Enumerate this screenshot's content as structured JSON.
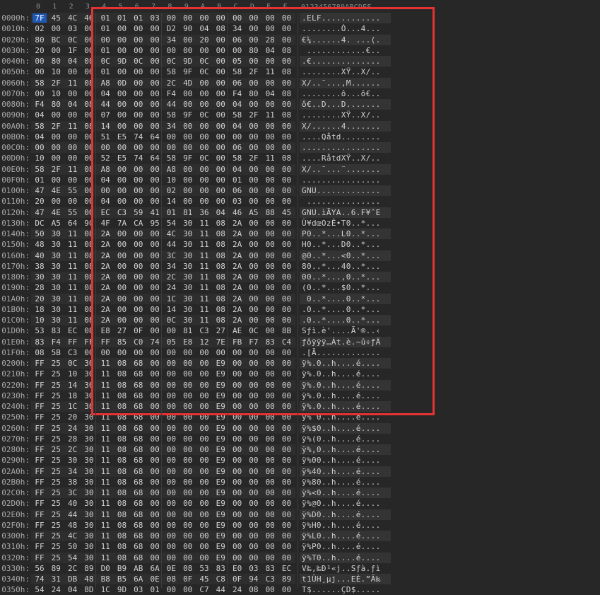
{
  "columns": [
    "0",
    "1",
    "2",
    "3",
    "4",
    "5",
    "6",
    "7",
    "8",
    "9",
    "A",
    "B",
    "C",
    "D",
    "E",
    "F"
  ],
  "ascii_header": "0123456789ABCDEF",
  "rows": [
    {
      "offset": "0000h:",
      "bytes": [
        "7F",
        "45",
        "4C",
        "46",
        "01",
        "01",
        "01",
        "03",
        "00",
        "00",
        "00",
        "00",
        "00",
        "00",
        "00",
        "00"
      ],
      "ascii": ".ELF............"
    },
    {
      "offset": "0010h:",
      "bytes": [
        "02",
        "00",
        "03",
        "00",
        "01",
        "00",
        "00",
        "00",
        "D2",
        "90",
        "04",
        "08",
        "34",
        "00",
        "00",
        "00"
      ],
      "ascii": "........Ò...4..."
    },
    {
      "offset": "0020h:",
      "bytes": [
        "80",
        "BC",
        "0C",
        "00",
        "00",
        "00",
        "00",
        "00",
        "34",
        "00",
        "20",
        "00",
        "06",
        "00",
        "28",
        "00"
      ],
      "ascii": "€¼......4. ...(."
    },
    {
      "offset": "0030h:",
      "bytes": [
        "20",
        "00",
        "1F",
        "00",
        "01",
        "00",
        "00",
        "00",
        "00",
        "00",
        "00",
        "00",
        "00",
        "80",
        "04",
        "08"
      ],
      "ascii": " ............€.."
    },
    {
      "offset": "0040h:",
      "bytes": [
        "00",
        "80",
        "04",
        "08",
        "0C",
        "9D",
        "0C",
        "00",
        "0C",
        "9D",
        "0C",
        "00",
        "05",
        "00",
        "00",
        "00"
      ],
      "ascii": ".€.............."
    },
    {
      "offset": "0050h:",
      "bytes": [
        "00",
        "10",
        "00",
        "00",
        "01",
        "00",
        "00",
        "00",
        "58",
        "9F",
        "0C",
        "00",
        "58",
        "2F",
        "11",
        "08"
      ],
      "ascii": "........XŸ..X/.."
    },
    {
      "offset": "0060h:",
      "bytes": [
        "58",
        "2F",
        "11",
        "08",
        "A8",
        "0D",
        "00",
        "00",
        "2C",
        "4D",
        "00",
        "00",
        "06",
        "00",
        "00",
        "00"
      ],
      "ascii": "X/..¨...,M......"
    },
    {
      "offset": "0070h:",
      "bytes": [
        "00",
        "10",
        "00",
        "00",
        "04",
        "00",
        "00",
        "00",
        "F4",
        "00",
        "00",
        "00",
        "F4",
        "80",
        "04",
        "08"
      ],
      "ascii": "........ô...ô€.."
    },
    {
      "offset": "0080h:",
      "bytes": [
        "F4",
        "80",
        "04",
        "08",
        "44",
        "00",
        "00",
        "00",
        "44",
        "00",
        "00",
        "00",
        "04",
        "00",
        "00",
        "00"
      ],
      "ascii": "ô€..D...D......."
    },
    {
      "offset": "0090h:",
      "bytes": [
        "04",
        "00",
        "00",
        "00",
        "07",
        "00",
        "00",
        "00",
        "58",
        "9F",
        "0C",
        "00",
        "58",
        "2F",
        "11",
        "08"
      ],
      "ascii": "........XŸ..X/.."
    },
    {
      "offset": "00A0h:",
      "bytes": [
        "58",
        "2F",
        "11",
        "08",
        "14",
        "00",
        "00",
        "00",
        "34",
        "00",
        "00",
        "00",
        "04",
        "00",
        "00",
        "00"
      ],
      "ascii": "X/......4......."
    },
    {
      "offset": "00B0h:",
      "bytes": [
        "04",
        "00",
        "00",
        "00",
        "51",
        "E5",
        "74",
        "64",
        "00",
        "00",
        "00",
        "00",
        "00",
        "00",
        "00",
        "00"
      ],
      "ascii": "....Qåtd........"
    },
    {
      "offset": "00C0h:",
      "bytes": [
        "00",
        "00",
        "00",
        "00",
        "00",
        "00",
        "00",
        "00",
        "00",
        "00",
        "00",
        "00",
        "06",
        "00",
        "00",
        "00"
      ],
      "ascii": "................"
    },
    {
      "offset": "00D0h:",
      "bytes": [
        "10",
        "00",
        "00",
        "00",
        "52",
        "E5",
        "74",
        "64",
        "58",
        "9F",
        "0C",
        "00",
        "58",
        "2F",
        "11",
        "08"
      ],
      "ascii": "....RåtdXŸ..X/.."
    },
    {
      "offset": "00E0h:",
      "bytes": [
        "58",
        "2F",
        "11",
        "08",
        "A8",
        "00",
        "00",
        "00",
        "A8",
        "00",
        "00",
        "00",
        "04",
        "00",
        "00",
        "00"
      ],
      "ascii": "X/..¨...¨......."
    },
    {
      "offset": "00F0h:",
      "bytes": [
        "01",
        "00",
        "00",
        "00",
        "04",
        "00",
        "00",
        "00",
        "10",
        "00",
        "00",
        "00",
        "01",
        "00",
        "00",
        "00"
      ],
      "ascii": "................"
    },
    {
      "offset": "0100h:",
      "bytes": [
        "47",
        "4E",
        "55",
        "00",
        "00",
        "00",
        "00",
        "00",
        "02",
        "00",
        "00",
        "00",
        "06",
        "00",
        "00",
        "00"
      ],
      "ascii": "GNU............."
    },
    {
      "offset": "0110h:",
      "bytes": [
        "20",
        "00",
        "00",
        "00",
        "04",
        "00",
        "00",
        "00",
        "14",
        "00",
        "00",
        "00",
        "03",
        "00",
        "00",
        "00"
      ],
      "ascii": " ..............."
    },
    {
      "offset": "0120h:",
      "bytes": [
        "47",
        "4E",
        "55",
        "00",
        "EC",
        "C3",
        "59",
        "41",
        "01",
        "81",
        "36",
        "04",
        "46",
        "A5",
        "88",
        "45"
      ],
      "ascii": "GNU.ìÃYA..6.F¥ˆE"
    },
    {
      "offset": "0130h:",
      "bytes": [
        "DC",
        "A5",
        "64",
        "9C",
        "4F",
        "7A",
        "CA",
        "95",
        "54",
        "30",
        "11",
        "08",
        "2A",
        "00",
        "00",
        "00"
      ],
      "ascii": "Ü¥dœOzÊ•T0..*..."
    },
    {
      "offset": "0140h:",
      "bytes": [
        "50",
        "30",
        "11",
        "08",
        "2A",
        "00",
        "00",
        "00",
        "4C",
        "30",
        "11",
        "08",
        "2A",
        "00",
        "00",
        "00"
      ],
      "ascii": "P0..*...L0..*..."
    },
    {
      "offset": "0150h:",
      "bytes": [
        "48",
        "30",
        "11",
        "08",
        "2A",
        "00",
        "00",
        "00",
        "44",
        "30",
        "11",
        "08",
        "2A",
        "00",
        "00",
        "00"
      ],
      "ascii": "H0..*...D0..*..."
    },
    {
      "offset": "0160h:",
      "bytes": [
        "40",
        "30",
        "11",
        "08",
        "2A",
        "00",
        "00",
        "00",
        "3C",
        "30",
        "11",
        "08",
        "2A",
        "00",
        "00",
        "00"
      ],
      "ascii": "@0..*...<0..*..."
    },
    {
      "offset": "0170h:",
      "bytes": [
        "38",
        "30",
        "11",
        "08",
        "2A",
        "00",
        "00",
        "00",
        "34",
        "30",
        "11",
        "08",
        "2A",
        "00",
        "00",
        "00"
      ],
      "ascii": "80..*...40..*..."
    },
    {
      "offset": "0180h:",
      "bytes": [
        "30",
        "30",
        "11",
        "08",
        "2A",
        "00",
        "00",
        "00",
        "2C",
        "30",
        "11",
        "08",
        "2A",
        "00",
        "00",
        "00"
      ],
      "ascii": "00..*...,0..*..."
    },
    {
      "offset": "0190h:",
      "bytes": [
        "28",
        "30",
        "11",
        "08",
        "2A",
        "00",
        "00",
        "00",
        "24",
        "30",
        "11",
        "08",
        "2A",
        "00",
        "00",
        "00"
      ],
      "ascii": "(0..*...$0..*..."
    },
    {
      "offset": "01A0h:",
      "bytes": [
        "20",
        "30",
        "11",
        "08",
        "2A",
        "00",
        "00",
        "00",
        "1C",
        "30",
        "11",
        "08",
        "2A",
        "00",
        "00",
        "00"
      ],
      "ascii": " 0..*....0..*..."
    },
    {
      "offset": "01B0h:",
      "bytes": [
        "18",
        "30",
        "11",
        "08",
        "2A",
        "00",
        "00",
        "00",
        "14",
        "30",
        "11",
        "08",
        "2A",
        "00",
        "00",
        "00"
      ],
      "ascii": ".0..*....0..*..."
    },
    {
      "offset": "01C0h:",
      "bytes": [
        "10",
        "30",
        "11",
        "08",
        "2A",
        "00",
        "00",
        "00",
        "0C",
        "30",
        "11",
        "08",
        "2A",
        "00",
        "00",
        "00"
      ],
      "ascii": ".0..*....0..*..."
    },
    {
      "offset": "01D0h:",
      "bytes": [
        "53",
        "83",
        "EC",
        "08",
        "E8",
        "27",
        "0F",
        "00",
        "00",
        "81",
        "C3",
        "27",
        "AE",
        "0C",
        "00",
        "8B"
      ],
      "ascii": "Sƒì.è'....Ã'®..‹"
    },
    {
      "offset": "01E0h:",
      "bytes": [
        "83",
        "F4",
        "FF",
        "FF",
        "FF",
        "85",
        "C0",
        "74",
        "05",
        "E8",
        "12",
        "7E",
        "FB",
        "F7",
        "83",
        "C4"
      ],
      "ascii": "ƒôÿÿÿ…Àt.è.~û÷ƒÄ"
    },
    {
      "offset": "01F0h:",
      "bytes": [
        "08",
        "5B",
        "C3",
        "00",
        "00",
        "00",
        "00",
        "00",
        "00",
        "00",
        "00",
        "00",
        "00",
        "00",
        "00",
        "00"
      ],
      "ascii": ".[Ã............."
    },
    {
      "offset": "0200h:",
      "bytes": [
        "FF",
        "25",
        "0C",
        "30",
        "11",
        "08",
        "68",
        "00",
        "00",
        "00",
        "00",
        "E9",
        "00",
        "00",
        "00",
        "00"
      ],
      "ascii": "ÿ%.0..h....é...."
    },
    {
      "offset": "0210h:",
      "bytes": [
        "FF",
        "25",
        "10",
        "30",
        "11",
        "08",
        "68",
        "00",
        "00",
        "00",
        "00",
        "E9",
        "00",
        "00",
        "00",
        "00"
      ],
      "ascii": "ÿ%.0..h....é...."
    },
    {
      "offset": "0220h:",
      "bytes": [
        "FF",
        "25",
        "14",
        "30",
        "11",
        "08",
        "68",
        "00",
        "00",
        "00",
        "00",
        "E9",
        "00",
        "00",
        "00",
        "00"
      ],
      "ascii": "ÿ%.0..h....é...."
    },
    {
      "offset": "0230h:",
      "bytes": [
        "FF",
        "25",
        "18",
        "30",
        "11",
        "08",
        "68",
        "00",
        "00",
        "00",
        "00",
        "E9",
        "00",
        "00",
        "00",
        "00"
      ],
      "ascii": "ÿ%.0..h....é...."
    },
    {
      "offset": "0240h:",
      "bytes": [
        "FF",
        "25",
        "1C",
        "30",
        "11",
        "08",
        "68",
        "00",
        "00",
        "00",
        "00",
        "E9",
        "00",
        "00",
        "00",
        "00"
      ],
      "ascii": "ÿ%.0..h....é...."
    },
    {
      "offset": "0250h:",
      "bytes": [
        "FF",
        "25",
        "20",
        "30",
        "11",
        "08",
        "68",
        "00",
        "00",
        "00",
        "00",
        "E9",
        "00",
        "00",
        "00",
        "00"
      ],
      "ascii": "ÿ% 0..h....é...."
    },
    {
      "offset": "0260h:",
      "bytes": [
        "FF",
        "25",
        "24",
        "30",
        "11",
        "08",
        "68",
        "00",
        "00",
        "00",
        "00",
        "E9",
        "00",
        "00",
        "00",
        "00"
      ],
      "ascii": "ÿ%$0..h....é...."
    },
    {
      "offset": "0270h:",
      "bytes": [
        "FF",
        "25",
        "28",
        "30",
        "11",
        "08",
        "68",
        "00",
        "00",
        "00",
        "00",
        "E9",
        "00",
        "00",
        "00",
        "00"
      ],
      "ascii": "ÿ%(0..h....é...."
    },
    {
      "offset": "0280h:",
      "bytes": [
        "FF",
        "25",
        "2C",
        "30",
        "11",
        "08",
        "68",
        "00",
        "00",
        "00",
        "00",
        "E9",
        "00",
        "00",
        "00",
        "00"
      ],
      "ascii": "ÿ%,0..h....é...."
    },
    {
      "offset": "0290h:",
      "bytes": [
        "FF",
        "25",
        "30",
        "30",
        "11",
        "08",
        "68",
        "00",
        "00",
        "00",
        "00",
        "E9",
        "00",
        "00",
        "00",
        "00"
      ],
      "ascii": "ÿ%00..h....é...."
    },
    {
      "offset": "02A0h:",
      "bytes": [
        "FF",
        "25",
        "34",
        "30",
        "11",
        "08",
        "68",
        "00",
        "00",
        "00",
        "00",
        "E9",
        "00",
        "00",
        "00",
        "00"
      ],
      "ascii": "ÿ%40..h....é...."
    },
    {
      "offset": "02B0h:",
      "bytes": [
        "FF",
        "25",
        "38",
        "30",
        "11",
        "08",
        "68",
        "00",
        "00",
        "00",
        "00",
        "E9",
        "00",
        "00",
        "00",
        "00"
      ],
      "ascii": "ÿ%80..h....é...."
    },
    {
      "offset": "02C0h:",
      "bytes": [
        "FF",
        "25",
        "3C",
        "30",
        "11",
        "08",
        "68",
        "00",
        "00",
        "00",
        "00",
        "E9",
        "00",
        "00",
        "00",
        "00"
      ],
      "ascii": "ÿ%<0..h....é...."
    },
    {
      "offset": "02D0h:",
      "bytes": [
        "FF",
        "25",
        "40",
        "30",
        "11",
        "08",
        "68",
        "00",
        "00",
        "00",
        "00",
        "E9",
        "00",
        "00",
        "00",
        "00"
      ],
      "ascii": "ÿ%@0..h....é...."
    },
    {
      "offset": "02E0h:",
      "bytes": [
        "FF",
        "25",
        "44",
        "30",
        "11",
        "08",
        "68",
        "00",
        "00",
        "00",
        "00",
        "E9",
        "00",
        "00",
        "00",
        "00"
      ],
      "ascii": "ÿ%D0..h....é...."
    },
    {
      "offset": "02F0h:",
      "bytes": [
        "FF",
        "25",
        "48",
        "30",
        "11",
        "08",
        "68",
        "00",
        "00",
        "00",
        "00",
        "E9",
        "00",
        "00",
        "00",
        "00"
      ],
      "ascii": "ÿ%H0..h....é...."
    },
    {
      "offset": "0300h:",
      "bytes": [
        "FF",
        "25",
        "4C",
        "30",
        "11",
        "08",
        "68",
        "00",
        "00",
        "00",
        "00",
        "E9",
        "00",
        "00",
        "00",
        "00"
      ],
      "ascii": "ÿ%L0..h....é...."
    },
    {
      "offset": "0310h:",
      "bytes": [
        "FF",
        "25",
        "50",
        "30",
        "11",
        "08",
        "68",
        "00",
        "00",
        "00",
        "00",
        "E9",
        "00",
        "00",
        "00",
        "00"
      ],
      "ascii": "ÿ%P0..h....é...."
    },
    {
      "offset": "0320h:",
      "bytes": [
        "FF",
        "25",
        "54",
        "30",
        "11",
        "08",
        "68",
        "00",
        "00",
        "00",
        "00",
        "E9",
        "00",
        "00",
        "00",
        "00"
      ],
      "ascii": "ÿ%T0..h....é...."
    },
    {
      "offset": "0330h:",
      "bytes": [
        "56",
        "89",
        "2C",
        "89",
        "D0",
        "B9",
        "AB",
        "6A",
        "0E",
        "08",
        "53",
        "83",
        "E0",
        "03",
        "83",
        "EC"
      ],
      "ascii": "V‰,‰Ð¹«j..Sƒà.ƒì"
    },
    {
      "offset": "0340h:",
      "bytes": [
        "74",
        "31",
        "DB",
        "48",
        "B8",
        "B5",
        "6A",
        "0E",
        "08",
        "0F",
        "45",
        "C8",
        "0F",
        "94",
        "C3",
        "89"
      ],
      "ascii": "t1ÛH¸µj...EÈ.”Ã‰"
    },
    {
      "offset": "0350h:",
      "bytes": [
        "54",
        "24",
        "04",
        "8D",
        "1C",
        "9D",
        "03",
        "01",
        "00",
        "00",
        "C7",
        "44",
        "24",
        "08",
        "00",
        "00"
      ],
      "ascii": "T$......ÇD$....."
    }
  ],
  "colors": {
    "background": "#272727",
    "selection": "#1f57b4",
    "annotation_box": "#e53232"
  }
}
